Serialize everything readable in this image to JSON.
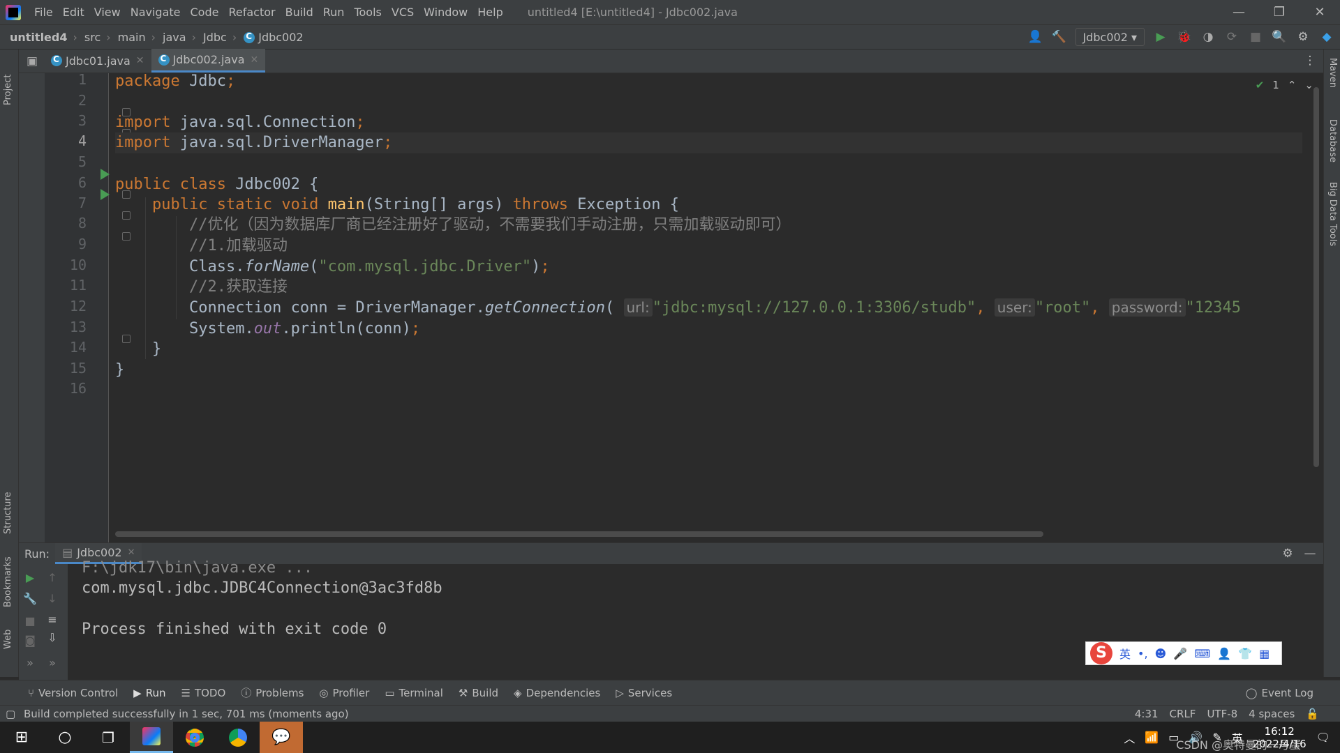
{
  "menubar": {
    "items": [
      "File",
      "Edit",
      "View",
      "Navigate",
      "Code",
      "Refactor",
      "Build",
      "Run",
      "Tools",
      "VCS",
      "Window",
      "Help"
    ],
    "title": "untitled4 [E:\\untitled4] - Jdbc002.java",
    "min": "—",
    "restore": "❐",
    "close": "✕"
  },
  "breadcrumb": [
    "untitled4",
    "src",
    "main",
    "java",
    "Jdbc",
    "Jdbc002"
  ],
  "run_config": "Jdbc002",
  "tabs": [
    {
      "label": "Jdbc01.java",
      "active": false
    },
    {
      "label": "Jdbc002.java",
      "active": true
    }
  ],
  "left_strip": {
    "project": "Project",
    "structure": "Structure",
    "bookmarks": "Bookmarks",
    "web": "Web"
  },
  "right_strip": {
    "maven": "Maven",
    "database": "Database",
    "bigdata": "Big Data Tools"
  },
  "inspection": {
    "count": "1"
  },
  "code": {
    "line_numbers": [
      "1",
      "2",
      "3",
      "4",
      "5",
      "6",
      "7",
      "8",
      "9",
      "10",
      "11",
      "12",
      "13",
      "14",
      "15",
      "16"
    ],
    "l1_kw": "package",
    "l1_rest": " Jdbc",
    "l1_semi": ";",
    "l3_kw": "import",
    "l3_rest": " java.sql.Connection",
    "l3_semi": ";",
    "l4_kw": "import",
    "l4_rest": " java.sql.DriverManager",
    "l4_semi": ";",
    "l6_kw": "public class",
    "l6_rest": " Jdbc002 {",
    "l7_kw1": "public static void",
    "l7_fn": "main",
    "l7_mid": "(String[] args) ",
    "l7_kw2": "throws",
    "l7_end": " Exception {",
    "l8": "//优化（因为数据库厂商已经注册好了驱动，不需要我们手动注册，只需加载驱动即可）",
    "l9": "//1.加载驱动",
    "l10_a": "Class.",
    "l10_fn": "forName",
    "l10_b": "(",
    "l10_str": "\"com.mysql.jdbc.Driver\"",
    "l10_c": ")",
    "l10_semi": ";",
    "l11": "//2.获取连接",
    "l12_a": "Connection conn = DriverManager.",
    "l12_fn": "getConnection",
    "l12_b": "(",
    "l12_h1": "url:",
    "l12_s1": "\"jdbc:mysql://127.0.0.1:3306/studb\"",
    "l12_c1": ",",
    "l12_h2": "user:",
    "l12_s2": "\"root\"",
    "l12_c2": ",",
    "l12_h3": "password:",
    "l12_s3": "\"12345",
    "l13_a": "System.",
    "l13_field": "out",
    "l13_b": ".println(conn)",
    "l13_semi": ";",
    "l14": "}",
    "l15": "}"
  },
  "run": {
    "label": "Run:",
    "tab": "Jdbc002",
    "console": [
      "F:\\jdk17\\bin\\java.exe ...",
      "com.mysql.jdbc.JDBC4Connection@3ac3fd8b",
      "",
      "Process finished with exit code 0"
    ]
  },
  "ime": {
    "logo": "S",
    "lang": "英"
  },
  "bottom_tools": [
    "Version Control",
    "Run",
    "TODO",
    "Problems",
    "Profiler",
    "Terminal",
    "Build",
    "Dependencies",
    "Services"
  ],
  "event_log": "Event Log",
  "status": {
    "message": "Build completed successfully in 1 sec, 701 ms (moments ago)",
    "position": "4:31",
    "line_sep": "CRLF",
    "encoding": "UTF-8",
    "indent": "4 spaces"
  },
  "taskbar": {
    "time": "16:12",
    "date": "2022/4/16",
    "ime": "英",
    "watermark": "CSDN @奥特曼的一号蛋"
  },
  "colors": {
    "keyword": "#cc7832",
    "string": "#6a8759",
    "comment": "#808080",
    "run_green": "#499c54",
    "accent": "#4a88c7"
  }
}
